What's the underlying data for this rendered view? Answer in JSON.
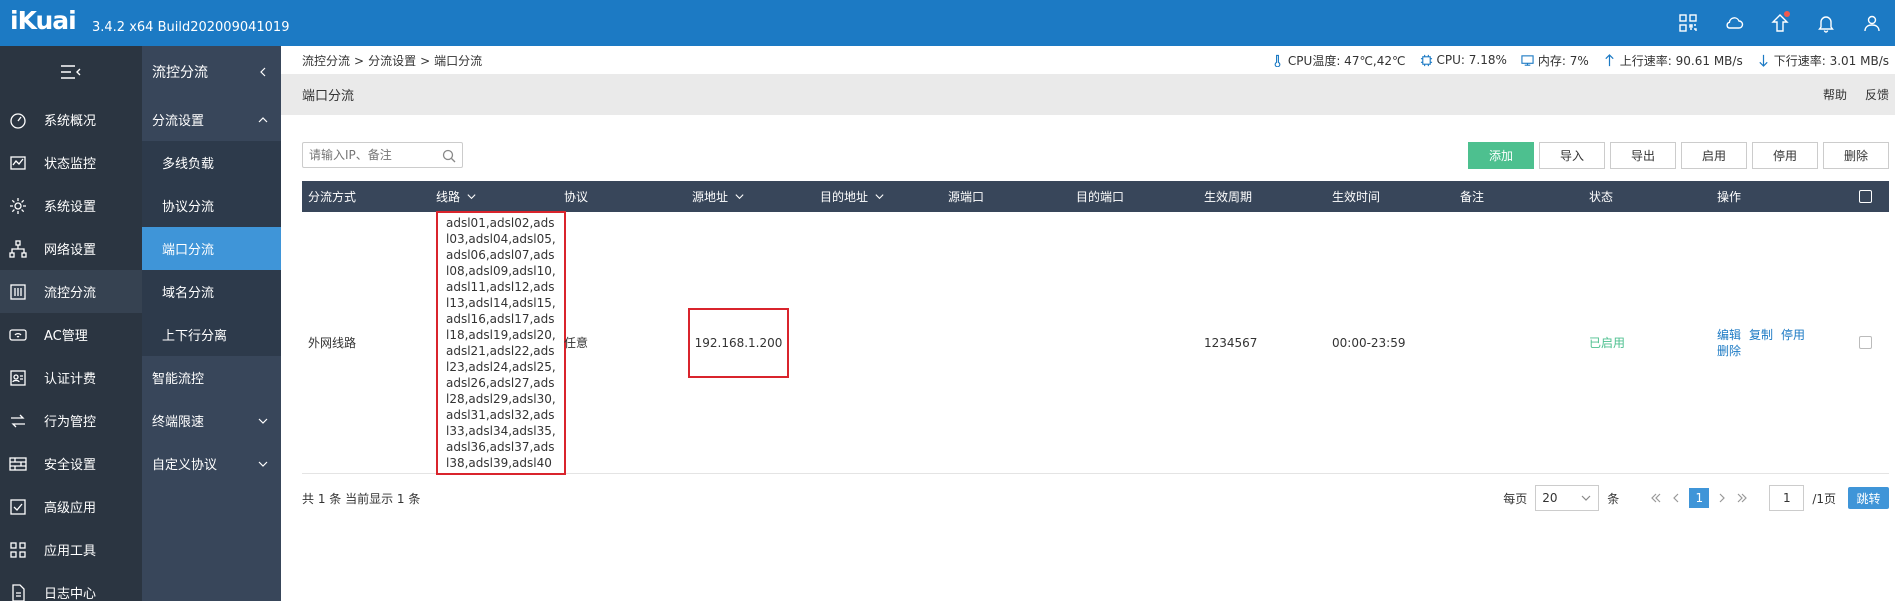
{
  "app": {
    "logo": "iKuai",
    "version": "3.4.2 x64 Build202009041019"
  },
  "top_icons": [
    "qr-code-icon",
    "cloud-icon",
    "upgrade-icon",
    "bell-icon",
    "user-icon"
  ],
  "sidebar": {
    "items": [
      {
        "label": "系统概况",
        "icon": "dashboard-icon"
      },
      {
        "label": "状态监控",
        "icon": "monitor-icon"
      },
      {
        "label": "系统设置",
        "icon": "gear-icon"
      },
      {
        "label": "网络设置",
        "icon": "network-icon"
      },
      {
        "label": "流控分流",
        "icon": "sliders-icon",
        "active": true
      },
      {
        "label": "AC管理",
        "icon": "wifi-icon"
      },
      {
        "label": "认证计费",
        "icon": "auth-icon"
      },
      {
        "label": "行为管控",
        "icon": "behavior-icon"
      },
      {
        "label": "安全设置",
        "icon": "firewall-icon"
      },
      {
        "label": "高级应用",
        "icon": "advanced-icon"
      },
      {
        "label": "应用工具",
        "icon": "tools-icon"
      },
      {
        "label": "日志中心",
        "icon": "log-icon"
      }
    ]
  },
  "subnav": {
    "title": "流控分流",
    "groups": {
      "split": "分流设置",
      "split_items": [
        "多线负载",
        "协议分流",
        "端口分流",
        "域名分流",
        "上下行分离"
      ],
      "smart": "智能流控",
      "terminal": "终端限速",
      "custom": "自定义协议"
    }
  },
  "breadcrumb": [
    "流控分流",
    "分流设置",
    "端口分流"
  ],
  "status": {
    "cpu_temp": "CPU温度: 47℃,42℃",
    "cpu": "CPU: 7.18%",
    "mem": "内存: 7%",
    "up": "上行速率: 90.61 MB/s",
    "down": "下行速率: 3.01 MB/s"
  },
  "page": {
    "title": "端口分流",
    "help": "帮助",
    "feedback": "反馈"
  },
  "search": {
    "placeholder": "请输入IP、备注"
  },
  "actions": {
    "add": "添加",
    "import": "导入",
    "export": "导出",
    "enable": "启用",
    "disable": "停用",
    "delete": "删除"
  },
  "table": {
    "headers": {
      "mode": "分流方式",
      "line": "线路",
      "protocol": "协议",
      "src_addr": "源地址",
      "dst_addr": "目的地址",
      "src_port": "源端口",
      "dst_port": "目的端口",
      "cycle": "生效周期",
      "time": "生效时间",
      "remark": "备注",
      "status": "状态",
      "ops": "操作"
    },
    "rows": [
      {
        "mode": "外网线路",
        "line": "adsl01,adsl02,adsl03,adsl04,adsl05,adsl06,adsl07,adsl08,adsl09,adsl10,adsl11,adsl12,adsl13,adsl14,adsl15,adsl16,adsl17,adsl18,adsl19,adsl20,adsl21,adsl22,adsl23,adsl24,adsl25,adsl26,adsl27,adsl28,adsl29,adsl30,adsl31,adsl32,adsl33,adsl34,adsl35,adsl36,adsl37,adsl38,adsl39,adsl40",
        "protocol": "任意",
        "src_addr": "192.168.1.200",
        "cycle": "1234567",
        "time": "00:00-23:59",
        "status": "已启用",
        "ops": {
          "edit": "编辑",
          "copy": "复制",
          "disable": "停用",
          "delete": "删除"
        }
      }
    ]
  },
  "pagination": {
    "summary": "共 1 条 当前显示 1 条",
    "per_page_label": "每页",
    "per_page": "20",
    "unit": "条",
    "current": "1",
    "input": "1",
    "total": "/1页",
    "jump": "跳转"
  },
  "colors": {
    "topbar": "#1c7ac4",
    "sidebar": "#2b3541",
    "subnav": "#38465a",
    "accent": "#3f95d8",
    "add": "#4dc08f",
    "highlight": "#d9242c"
  }
}
